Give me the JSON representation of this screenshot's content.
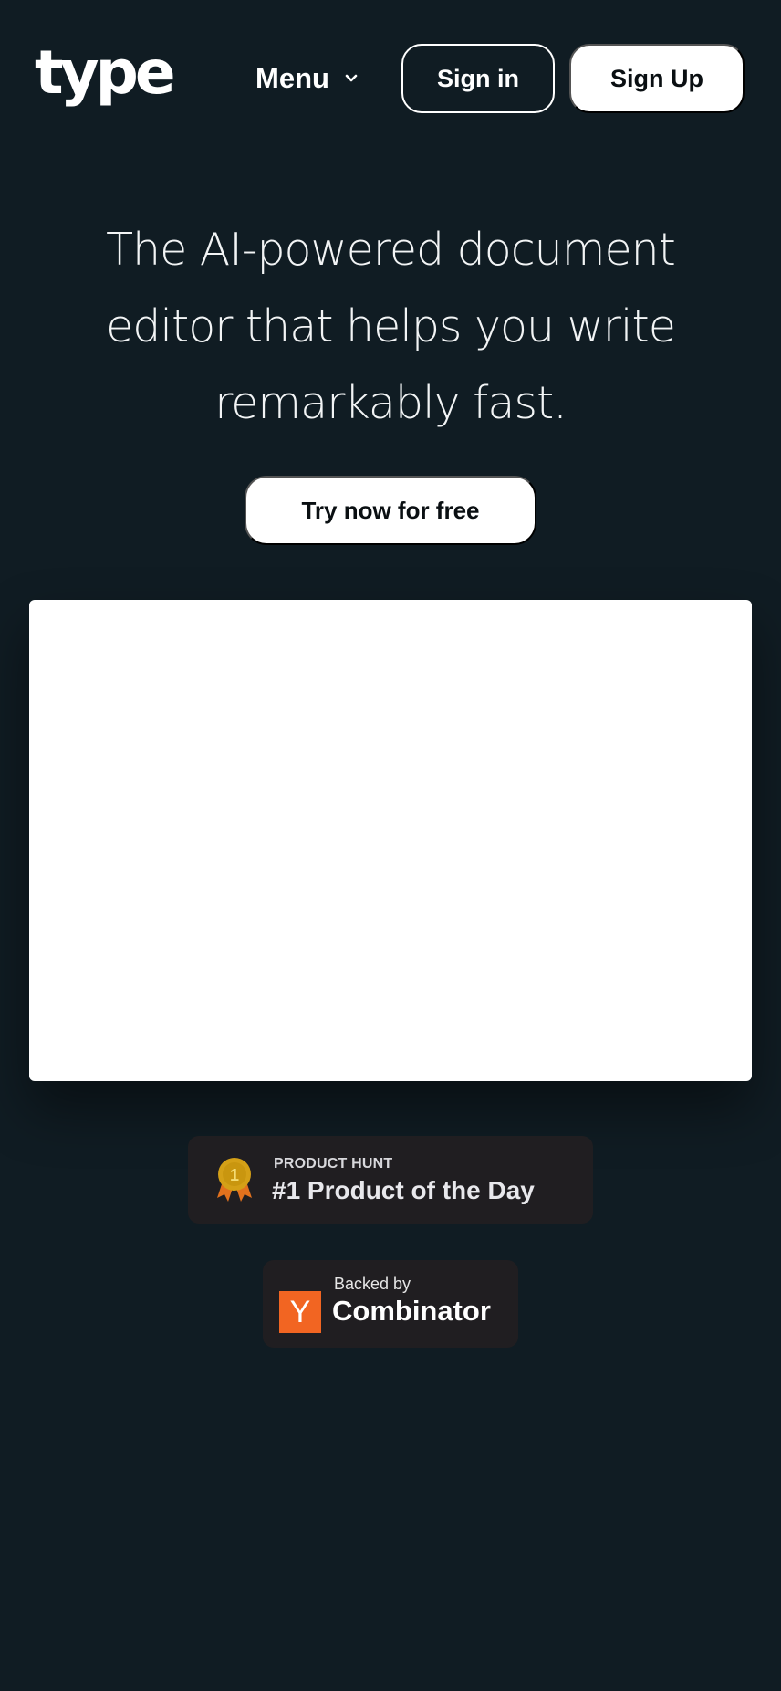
{
  "header": {
    "logo_text": "type",
    "menu_label": "Menu",
    "menu_icon": "chevron-down-icon",
    "signin_label": "Sign in",
    "signup_label": "Sign Up"
  },
  "hero": {
    "headline": "The AI-powered document editor that helps you write remarkably fast.",
    "cta_label": "Try now for free"
  },
  "badges": {
    "product_hunt": {
      "kicker": "PRODUCT HUNT",
      "title": "#1 Product of the Day",
      "medal_number": "1",
      "icon": "medal-icon"
    },
    "ycombinator": {
      "kicker": "Backed by",
      "name": "Combinator",
      "logo_letter": "Y",
      "brand_color": "#f26522"
    }
  },
  "colors": {
    "background": "#101c23",
    "badge_background": "#201e21",
    "medal_gold": "#d4a017",
    "medal_ribbon": "#e2711d"
  }
}
